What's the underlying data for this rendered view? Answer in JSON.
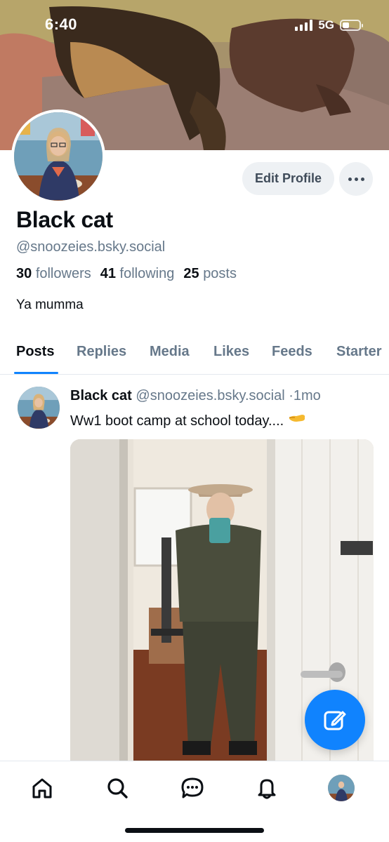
{
  "status_bar": {
    "time": "6:40",
    "network": "5G",
    "battery_level": 0.3
  },
  "banner": {
    "image": "two dogs sleeping on a couch"
  },
  "profile": {
    "avatar": "profile photo",
    "display_name": "Black cat",
    "handle": "@snoozeies.bsky.social",
    "followers_count": "30",
    "followers_label": "followers",
    "following_count": "41",
    "following_label": "following",
    "posts_count": "25",
    "posts_label": "posts",
    "bio": "Ya mumma",
    "edit_profile_label": "Edit Profile",
    "more_icon": "ellipsis-icon"
  },
  "tabs": [
    {
      "label": "Posts",
      "active": true
    },
    {
      "label": "Replies",
      "active": false
    },
    {
      "label": "Media",
      "active": false
    },
    {
      "label": "Likes",
      "active": false
    },
    {
      "label": "Feeds",
      "active": false
    },
    {
      "label": "Starter",
      "active": false
    }
  ],
  "post": {
    "author": "Black cat",
    "handle": "@snoozeies.bsky.social",
    "separator": "·",
    "time": "1mo",
    "text": "Ww1 boot camp at school today....",
    "emoji": "backhand-pointing-left-emoji",
    "image": "mirror selfie in olive uniform and hat"
  },
  "fab": {
    "icon": "compose-icon"
  },
  "bottom_nav": [
    {
      "name": "home",
      "icon": "home-icon"
    },
    {
      "name": "search",
      "icon": "search-icon"
    },
    {
      "name": "chat",
      "icon": "chat-icon"
    },
    {
      "name": "notifications",
      "icon": "bell-icon"
    },
    {
      "name": "profile",
      "icon": "avatar"
    }
  ],
  "colors": {
    "accent": "#1083fe",
    "text": "#0b0f14",
    "muted": "#66788a",
    "button_bg": "#eef1f4"
  }
}
